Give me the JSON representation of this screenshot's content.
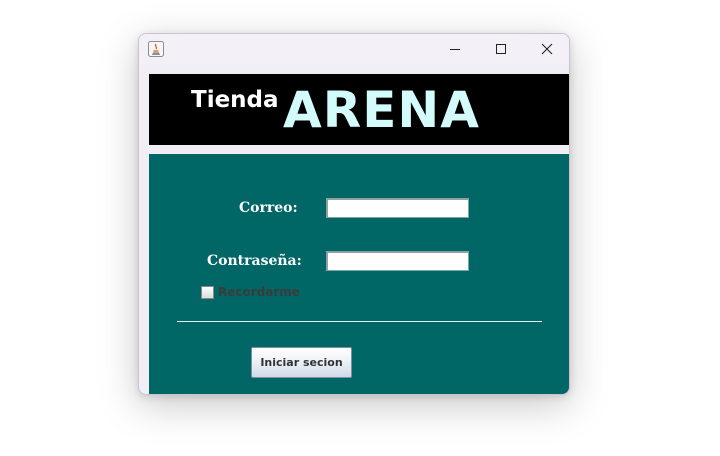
{
  "window": {
    "controls": {
      "minimize_icon": "minimize-icon",
      "maximize_icon": "maximize-icon",
      "close_icon": "close-icon"
    },
    "app_icon": "java-icon"
  },
  "banner": {
    "small_text": "Tienda",
    "big_text": "ARENA",
    "background": "#000000",
    "big_text_color": "#d4fbfb"
  },
  "form": {
    "background": "#006666",
    "email_label": "Correo:",
    "email_value": "",
    "password_label": "Contraseña:",
    "password_value": "",
    "remember_label": "Recordarme",
    "remember_checked": false,
    "login_button": "Iniciar secion"
  }
}
